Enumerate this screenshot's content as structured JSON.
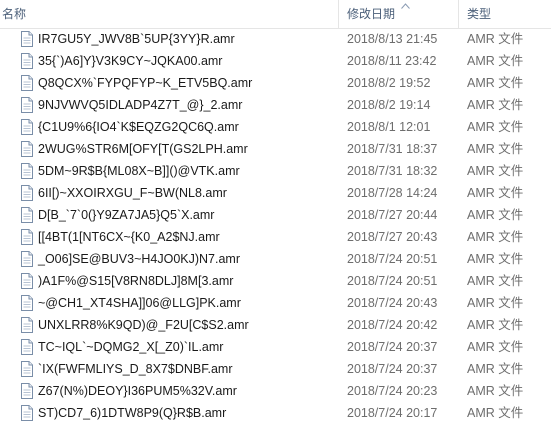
{
  "header": {
    "name": "名称",
    "date_modified": "修改日期",
    "type": "类型"
  },
  "files": [
    {
      "name": "IR7GU5Y_JWV8B`5UP{3YY}R.amr",
      "date": "2018/8/13 21:45",
      "type": "AMR 文件"
    },
    {
      "name": "35{`)A6]Y}V3K9CY~JQKA00.amr",
      "date": "2018/8/11 23:42",
      "type": "AMR 文件"
    },
    {
      "name": "Q8QCX%`FYPQFYP~K_ETV5BQ.amr",
      "date": "2018/8/2 19:52",
      "type": "AMR 文件"
    },
    {
      "name": "9NJVWVQ5IDLADP4Z7T_@}_2.amr",
      "date": "2018/8/2 19:14",
      "type": "AMR 文件"
    },
    {
      "name": "{C1U9%6{IO4`K$EQZG2QC6Q.amr",
      "date": "2018/8/1 12:01",
      "type": "AMR 文件"
    },
    {
      "name": "2WUG%STR6M[OFY[T(GS2LPH.amr",
      "date": "2018/7/31 18:37",
      "type": "AMR 文件"
    },
    {
      "name": "5DM~9R$B{ML08X~B]]()@VTK.amr",
      "date": "2018/7/31 18:32",
      "type": "AMR 文件"
    },
    {
      "name": "6II[)~XXOIRXGU_F~BW(NL8.amr",
      "date": "2018/7/28 14:24",
      "type": "AMR 文件"
    },
    {
      "name": "D[B_`7`0(}Y9ZA7JA5}Q5`X.amr",
      "date": "2018/7/27 20:44",
      "type": "AMR 文件"
    },
    {
      "name": "[[4BT(1[NT6CX~{K0_A2$NJ.amr",
      "date": "2018/7/27 20:43",
      "type": "AMR 文件"
    },
    {
      "name": "_O06]SE@BUV3~H4JO0KJ)N7.amr",
      "date": "2018/7/24 20:51",
      "type": "AMR 文件"
    },
    {
      "name": ")A1F%@S15[V8RN8DLJ]8M[3.amr",
      "date": "2018/7/24 20:51",
      "type": "AMR 文件"
    },
    {
      "name": "~@CH1_XT4SHA]]06@LLG]PK.amr",
      "date": "2018/7/24 20:43",
      "type": "AMR 文件"
    },
    {
      "name": "UNXLRR8%K9QD)@_F2U[C$S2.amr",
      "date": "2018/7/24 20:42",
      "type": "AMR 文件"
    },
    {
      "name": "TC~IQL`~DQMG2_X[_Z0)`IL.amr",
      "date": "2018/7/24 20:37",
      "type": "AMR 文件"
    },
    {
      "name": "`IX(FWFMLIYS_D_8X7$DNBF.amr",
      "date": "2018/7/24 20:37",
      "type": "AMR 文件"
    },
    {
      "name": "Z67(N%)DEOY}I36PUM5%32V.amr",
      "date": "2018/7/24 20:23",
      "type": "AMR 文件"
    },
    {
      "name": "ST)CD7_6)1DTW8P9(Q}R$B.amr",
      "date": "2018/7/24 20:17",
      "type": "AMR 文件"
    }
  ],
  "colors": {
    "header_text": "#4c607a",
    "name_text": "#1a1a1a",
    "meta_text": "#6d6d6d",
    "icon_border": "#7a8ea8"
  },
  "icons": {
    "file": "file-icon",
    "sort": "chevron-up-icon"
  }
}
